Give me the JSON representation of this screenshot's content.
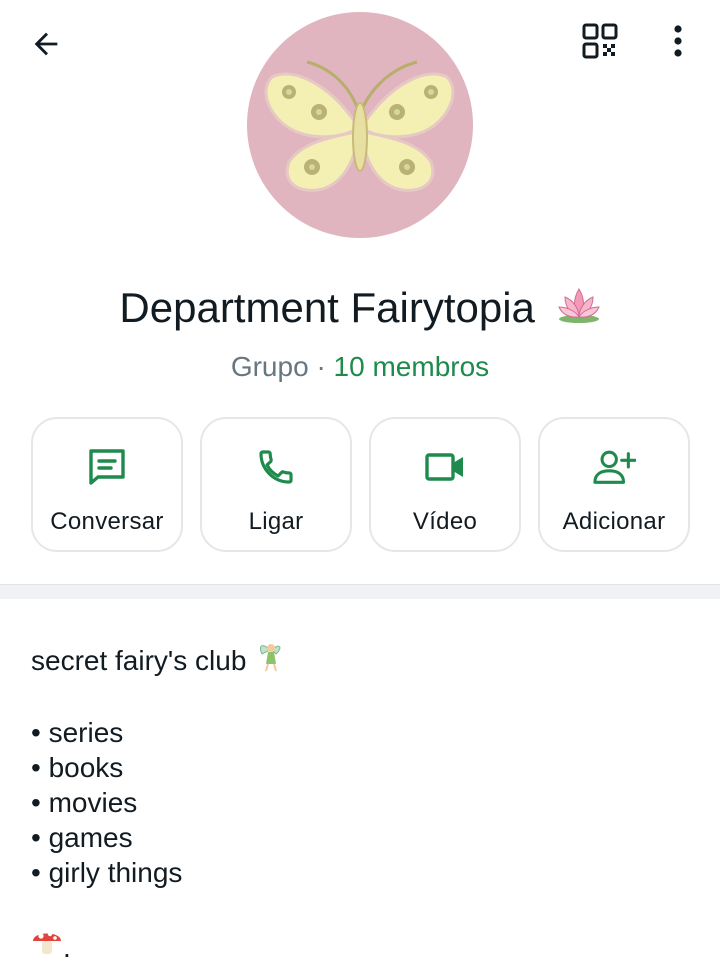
{
  "header": {
    "back_icon": "arrow-back-icon",
    "qr_icon": "qr-code-icon",
    "menu_icon": "more-vertical-icon"
  },
  "group": {
    "name": "Department Fairytopia",
    "name_emoji": "lotus-emoji",
    "type_label": "Grupo",
    "separator": "·",
    "members_label": "10 membros",
    "avatar": "butterfly-embroidery-image",
    "avatar_bg": "#e0b5bf"
  },
  "actions": [
    {
      "label": "Conversar",
      "icon": "message-icon"
    },
    {
      "label": "Ligar",
      "icon": "phone-icon"
    },
    {
      "label": "Vídeo",
      "icon": "video-icon"
    },
    {
      "label": "Adicionar",
      "icon": "add-person-icon"
    }
  ],
  "description": {
    "title": "secret fairy's club",
    "title_emoji": "fairy-emoji",
    "items": [
      "• series",
      "• books",
      "• movies",
      "• games",
      "• girly things"
    ],
    "footer_emoji": "mushroom-emoji",
    "footer_text": "."
  },
  "colors": {
    "accent_green": "#1e8a4c",
    "text": "#111b21",
    "muted": "#667781",
    "border": "#e4e7e9"
  }
}
